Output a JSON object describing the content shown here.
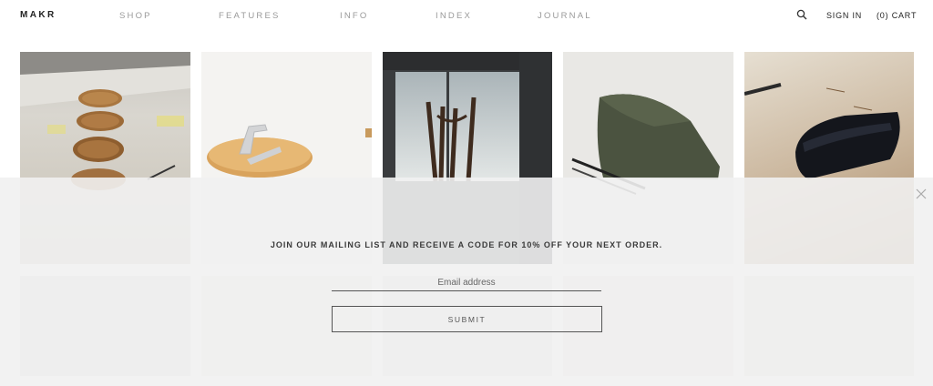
{
  "header": {
    "logo": "MAKR",
    "nav": [
      {
        "label": "SHOP"
      },
      {
        "label": "FEATURES"
      },
      {
        "label": "INFO"
      },
      {
        "label": "INDEX"
      },
      {
        "label": "JOURNAL"
      }
    ],
    "search_icon": "search-icon",
    "sign_in": "SIGN IN",
    "cart": "(0) CART"
  },
  "products": [
    {
      "depicts": "wooden-plates"
    },
    {
      "depicts": "wooden-board-with-metal-handle"
    },
    {
      "depicts": "wooden-stand"
    },
    {
      "depicts": "olive-canvas-pouch"
    },
    {
      "depicts": "black-canvas-pouch"
    }
  ],
  "popup": {
    "message": "JOIN OUR MAILING LIST AND RECEIVE A CODE FOR 10% OFF YOUR NEXT ORDER.",
    "email_placeholder": "Email address",
    "submit_label": "SUBMIT",
    "close_icon": "close-icon"
  },
  "colors": {
    "nav_text": "#9a9a9a",
    "text_dark": "#222222",
    "overlay": "#f1f1f1"
  }
}
